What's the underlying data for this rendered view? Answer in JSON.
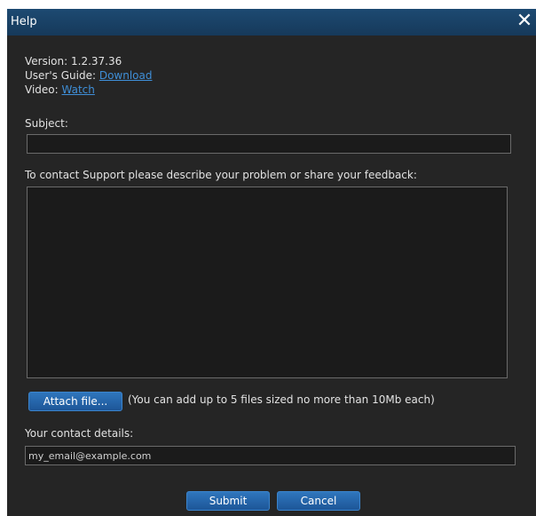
{
  "window": {
    "title": "Help",
    "close_glyph": "✕"
  },
  "info": {
    "version_label": "Version:",
    "version_value": "1.2.37.36",
    "guide_label": "User's Guide:",
    "guide_link": "Download",
    "video_label": "Video:",
    "video_link": "Watch"
  },
  "subject": {
    "label": "Subject:",
    "value": ""
  },
  "description": {
    "label": "To contact Support please describe your problem or share your feedback:",
    "value": ""
  },
  "attach": {
    "button_label": "Attach file...",
    "note": "(You can add up to 5 files sized no more than 10Mb each)"
  },
  "contact": {
    "label": "Your contact details:",
    "value": "my_email@example.com"
  },
  "actions": {
    "submit_label": "Submit",
    "cancel_label": "Cancel"
  }
}
